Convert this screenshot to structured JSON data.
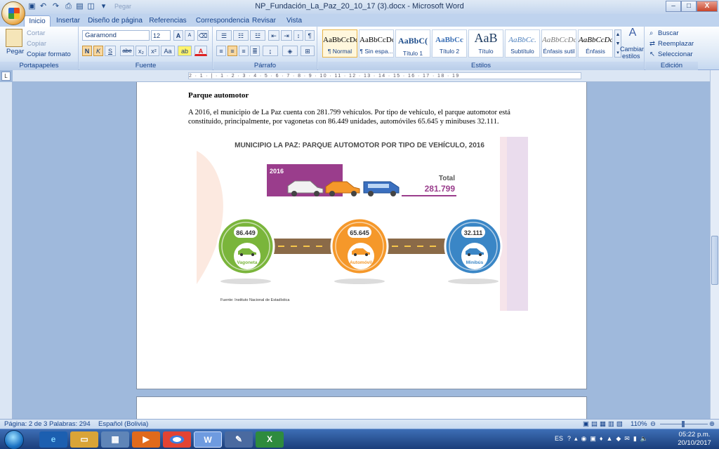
{
  "window": {
    "title": "NP_Fundación_La_Paz_20_10_17 (3).docx - Microsoft Word",
    "qat_undo": "↶",
    "qat_redo": "↷",
    "qat_hint": "Pegar",
    "min": "–",
    "max": "□",
    "close": "X"
  },
  "tabs": [
    "Inicio",
    "Insertar",
    "Diseño de página",
    "Referencias",
    "Correspondencia",
    "Revisar",
    "Vista"
  ],
  "ribbon": {
    "clipboard": {
      "label": "Portapapeles",
      "paste": "Pegar",
      "cut": "Cortar",
      "copy": "Copiar",
      "format": "Copiar formato"
    },
    "font": {
      "label": "Fuente",
      "name": "Garamond",
      "size": "12",
      "grow": "A",
      "shrink": "A",
      "clear": "⌫",
      "bold": "N",
      "italic": "K",
      "underline": "S",
      "strike": "abe",
      "sub": "x₂",
      "sup": "x²",
      "case": "Aa",
      "highlight": "ab",
      "color": "A"
    },
    "paragraph": {
      "label": "Párrafo",
      "pilcrow": "¶"
    },
    "styles": {
      "label": "Estilos",
      "items": [
        {
          "sample": "AaBbCcDc",
          "name": "¶ Normal"
        },
        {
          "sample": "AaBbCcDc",
          "name": "¶ Sin espa..."
        },
        {
          "sample": "AaBbC(",
          "name": "Título 1"
        },
        {
          "sample": "AaBbCc",
          "name": "Título 2"
        },
        {
          "sample": "AaB",
          "name": "Título"
        },
        {
          "sample": "AaBbCc.",
          "name": "Subtítulo"
        },
        {
          "sample": "AaBbCcDc",
          "name": "Énfasis sutil"
        },
        {
          "sample": "AaBbCcDc",
          "name": "Énfasis"
        }
      ],
      "change": "Cambiar",
      "change2": "estilos"
    },
    "editing": {
      "label": "Edición",
      "find": "Buscar",
      "replace": "Reemplazar",
      "select": "Seleccionar"
    }
  },
  "ruler": {
    "ticks": "2 · 1 · | · 1 · 2 · 3 · 4 · 5 · 6 · 7 · 8 · 9 · 10 · 11 · 12 · 13 · 14 · 15 · 16 · 17 · 18 · 19",
    "corner": "L"
  },
  "document": {
    "heading": "Parque automotor",
    "paragraph": "A 2016, el municipio de La Paz cuenta con 281.799 vehículos. Por tipo de vehículo, el parque automotor está constituido, principalmente, por vagonetas con 86.449 unidades, automóviles 65.645 y minibuses 32.111."
  },
  "infographic": {
    "title": "MUNICIPIO LA PAZ: PARQUE AUTOMOTOR POR TIPO DE VEHÍCULO, 2016",
    "year": "2016",
    "total_label": "Total",
    "total_value": "281.799",
    "source": "Fuente: Instituto Nacional de Estadística",
    "items": [
      {
        "value": "86.449",
        "label": "Vagoneta",
        "color": "#7ab53b"
      },
      {
        "value": "65.645",
        "label": "Automóvil",
        "color": "#f5982a"
      },
      {
        "value": "32.111",
        "label": "Minibús",
        "color": "#3a86c6"
      }
    ],
    "colors": {
      "banner": "#9a3d8c",
      "road": "#8a6a48",
      "lane": "#f6c64a",
      "title": "#4a4a4a"
    }
  },
  "status": {
    "page": "Página: 2 de 3",
    "words": "Palabras: 294",
    "lang": "Español (Bolivia)",
    "zoom": "110%"
  },
  "taskbar": {
    "lang": "ES",
    "time": "05:22 p.m.",
    "date": "20/10/2017"
  }
}
